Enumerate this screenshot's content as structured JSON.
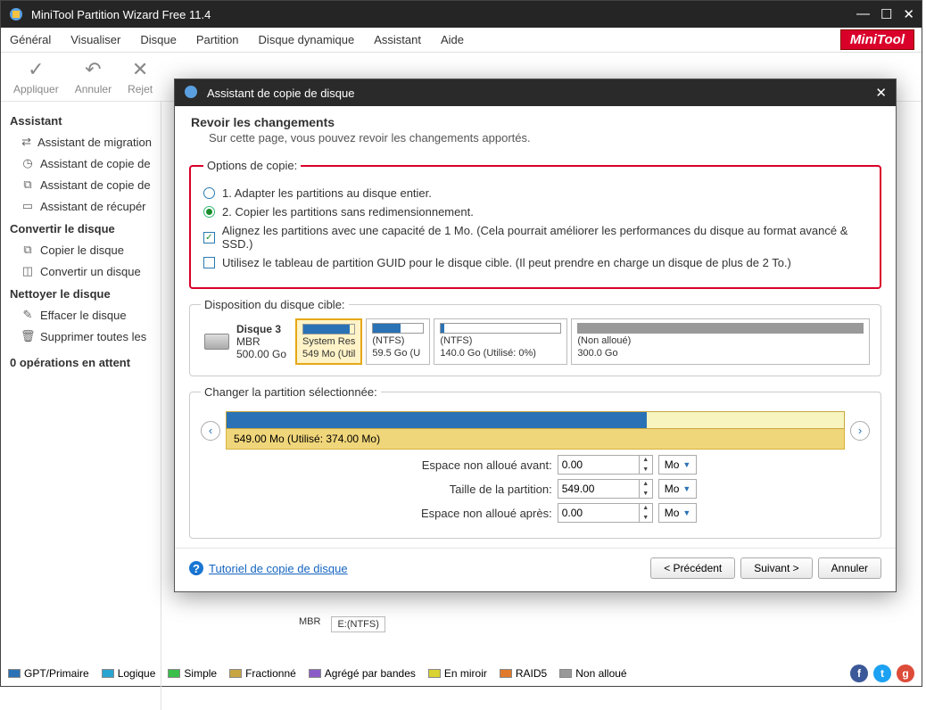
{
  "window": {
    "title": "MiniTool Partition Wizard Free 11.4"
  },
  "brand": "MiniTool",
  "menu": {
    "items": [
      "Général",
      "Visualiser",
      "Disque",
      "Partition",
      "Disque dynamique",
      "Assistant",
      "Aide"
    ]
  },
  "toolbar": {
    "apply": "Appliquer",
    "cancel": "Annuler",
    "reject": "Rejet"
  },
  "sidebar": {
    "h1": "Assistant",
    "g1": [
      "Assistant de migration",
      "Assistant de copie de",
      "Assistant de copie de",
      "Assistant de récupér"
    ],
    "h2": "Convertir le disque",
    "g2": [
      "Copier le disque",
      "Convertir un disque"
    ],
    "h3": "Nettoyer le disque",
    "g3": [
      "Effacer le disque",
      "Supprimer toutes les"
    ]
  },
  "ops": "0 opérations en attent",
  "legend": {
    "gpt": "GPT/Primaire",
    "log": "Logique",
    "simple": "Simple",
    "frac": "Fractionné",
    "agg": "Agrégé par bandes",
    "mirror": "En miroir",
    "raid": "RAID5",
    "unalloc": "Non alloué"
  },
  "dialog": {
    "title": "Assistant de copie de disque",
    "heading": "Revoir les changements",
    "sub": "Sur cette page, vous pouvez revoir les changements apportés.",
    "optsLegend": "Options de copie:",
    "r1": "1. Adapter les partitions au disque entier.",
    "r2": "2. Copier les partitions sans redimensionnement.",
    "c1": "Alignez les partitions avec une capacité de 1 Mo. (Cela pourrait améliorer les performances du disque au format avancé & SSD.)",
    "c2": "Utilisez le tableau de partition GUID pour le disque cible. (Il peut prendre en charge un disque de plus de 2 To.)",
    "targetLegend": "Disposition du disque cible:",
    "disk": {
      "name": "Disque 3",
      "scheme": "MBR",
      "size": "500.00 Go"
    },
    "parts": [
      {
        "name": "System Res",
        "size": "549 Mo (Util",
        "fill": 90,
        "sel": true
      },
      {
        "name": "(NTFS)",
        "size": "59.5 Go (U",
        "fill": 55
      },
      {
        "name": "(NTFS)",
        "size": "140.0 Go (Utilisé: 0%)",
        "fill": 3
      },
      {
        "name": "(Non alloué)",
        "size": "300.0 Go",
        "fill": 0,
        "un": true
      }
    ],
    "selLegend": "Changer la partition sélectionnée:",
    "barLabel": "549.00 Mo (Utilisé: 374.00 Mo)",
    "barFill": 68,
    "form": {
      "before": {
        "label": "Espace non alloué avant:",
        "val": "0.00",
        "unit": "Mo"
      },
      "size": {
        "label": "Taille de la partition:",
        "val": "549.00",
        "unit": "Mo"
      },
      "after": {
        "label": "Espace non alloué après:",
        "val": "0.00",
        "unit": "Mo"
      }
    },
    "tutorial": "Tutoriel de copie de disque",
    "prev": "< Précédent",
    "next": "Suivant >",
    "cancel": "Annuler"
  },
  "bg": {
    "scheme": "MBR",
    "part": "E:(NTFS)"
  }
}
